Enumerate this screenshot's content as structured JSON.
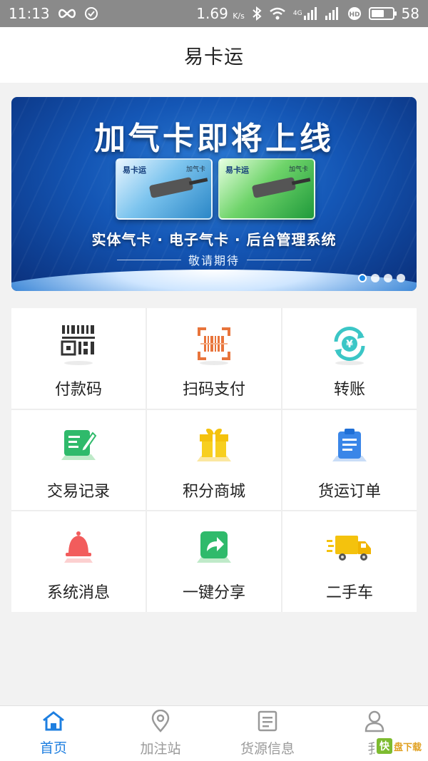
{
  "status_bar": {
    "time": "11:13",
    "speed": "1.69",
    "speed_unit": "K/s",
    "network": "4G",
    "battery": "58"
  },
  "header": {
    "title": "易卡运"
  },
  "banner": {
    "headline": "加气卡即将上线",
    "card_brand": "易卡运",
    "card_tag": "加气卡",
    "subline": "实体气卡 · 电子气卡 · 后台管理系统",
    "tagline": "敬请期待",
    "slide_count": 4,
    "active_slide": 1
  },
  "grid": {
    "items": [
      {
        "label": "付款码",
        "icon": "payment-qr-icon"
      },
      {
        "label": "扫码支付",
        "icon": "scan-barcode-icon"
      },
      {
        "label": "转账",
        "icon": "transfer-yuan-icon"
      },
      {
        "label": "交易记录",
        "icon": "edit-record-icon"
      },
      {
        "label": "积分商城",
        "icon": "gift-icon"
      },
      {
        "label": "货运订单",
        "icon": "clipboard-icon"
      },
      {
        "label": "系统消息",
        "icon": "bell-icon"
      },
      {
        "label": "一键分享",
        "icon": "share-icon"
      },
      {
        "label": "二手车",
        "icon": "truck-icon"
      }
    ]
  },
  "bottom_nav": {
    "items": [
      {
        "label": "首页",
        "icon": "home-icon",
        "active": true
      },
      {
        "label": "加注站",
        "icon": "location-pin-icon",
        "active": false
      },
      {
        "label": "货源信息",
        "icon": "document-list-icon",
        "active": false
      },
      {
        "label": "我",
        "icon": "person-icon",
        "active": false
      }
    ]
  },
  "watermark": {
    "logo": "快",
    "text": "盘下载"
  },
  "colors": {
    "accent": "#1e7fe0",
    "inactive": "#999999"
  }
}
